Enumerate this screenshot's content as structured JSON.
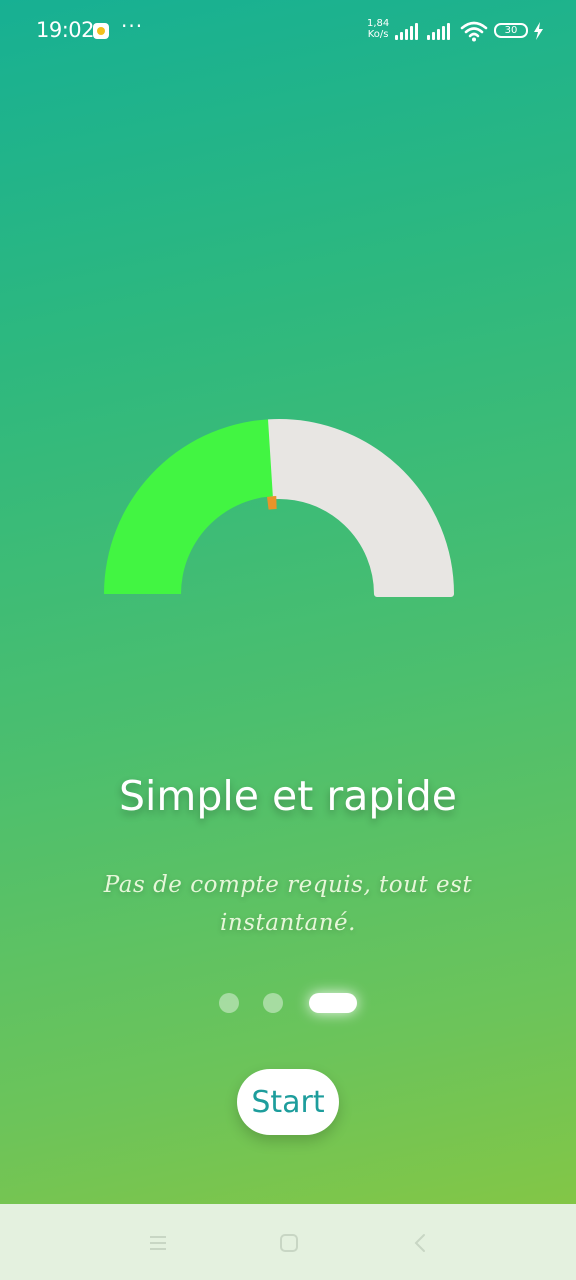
{
  "status_bar": {
    "time": "19:02",
    "more": "···",
    "net_speed_value": "1,84",
    "net_speed_unit": "Ko/s",
    "battery": "30"
  },
  "gauge": {
    "value_fraction": 0.48,
    "colors": {
      "fill": "#42f542",
      "track": "#e8e6e3",
      "needle": "#e8942a"
    }
  },
  "onboarding": {
    "title": "Simple et rapide",
    "subtitle": "Pas de compte requis, tout est instantané.",
    "pages": 3,
    "active_page": 3,
    "start_label": "Start"
  },
  "colors": {
    "bg_top": "#17b093",
    "bg_bottom": "#8bc73f",
    "button_text": "#1d9d9c"
  },
  "nav_bar": {
    "icons": [
      "menu-icon",
      "home-icon",
      "back-icon"
    ]
  }
}
